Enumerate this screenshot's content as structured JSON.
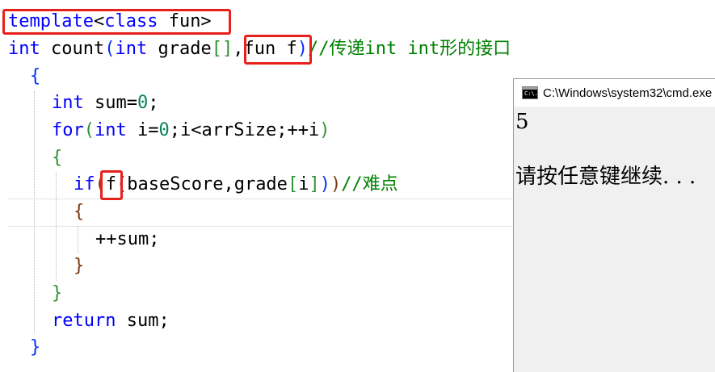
{
  "editor": {
    "lines": [
      {
        "tokens": [
          {
            "t": "template",
            "c": "kw"
          },
          {
            "t": "<",
            "c": ""
          },
          {
            "t": "class",
            "c": "kw"
          },
          {
            "t": " fun>",
            "c": ""
          }
        ]
      },
      {
        "tokens": [
          {
            "t": "int",
            "c": "kw"
          },
          {
            "t": " count",
            "c": ""
          },
          {
            "t": "(",
            "c": "br1"
          },
          {
            "t": "int",
            "c": "kw"
          },
          {
            "t": " grade",
            "c": ""
          },
          {
            "t": "[]",
            "c": "br2"
          },
          {
            "t": ",fun f",
            "c": ""
          },
          {
            "t": ")",
            "c": "br1"
          },
          {
            "t": "//传递",
            "c": "cm"
          },
          {
            "t": "int int",
            "c": "cm"
          },
          {
            "t": "形的接口",
            "c": "cm"
          }
        ]
      },
      {
        "tokens": [
          {
            "t": "{",
            "c": "br1"
          }
        ]
      },
      {
        "tokens": [
          {
            "t": "int",
            "c": "kw"
          },
          {
            "t": " sum=",
            "c": ""
          },
          {
            "t": "0",
            "c": "num"
          },
          {
            "t": ";",
            "c": ""
          }
        ]
      },
      {
        "tokens": [
          {
            "t": "for",
            "c": "kw"
          },
          {
            "t": "(",
            "c": "br2"
          },
          {
            "t": "int",
            "c": "kw"
          },
          {
            "t": " i=",
            "c": ""
          },
          {
            "t": "0",
            "c": "num"
          },
          {
            "t": ";i<arrSize;++i",
            "c": ""
          },
          {
            "t": ")",
            "c": "br2"
          }
        ]
      },
      {
        "tokens": [
          {
            "t": "{",
            "c": "br2"
          }
        ]
      },
      {
        "tokens": [
          {
            "t": "if",
            "c": "kw"
          },
          {
            "t": "(",
            "c": "br3"
          },
          {
            "t": "f",
            "c": ""
          },
          {
            "t": "(",
            "c": "br1"
          },
          {
            "t": "baseScore,grade",
            "c": ""
          },
          {
            "t": "[",
            "c": "br2"
          },
          {
            "t": "i",
            "c": ""
          },
          {
            "t": "]",
            "c": "br2"
          },
          {
            "t": ")",
            "c": "br1"
          },
          {
            "t": ")",
            "c": "br3"
          },
          {
            "t": "//难点",
            "c": "cm"
          }
        ]
      },
      {
        "tokens": [
          {
            "t": "{",
            "c": "br3"
          }
        ]
      },
      {
        "tokens": [
          {
            "t": "++sum;",
            "c": ""
          }
        ]
      },
      {
        "tokens": [
          {
            "t": "}",
            "c": "br3"
          }
        ]
      },
      {
        "tokens": [
          {
            "t": "}",
            "c": "br2"
          }
        ]
      },
      {
        "tokens": [
          {
            "t": "return",
            "c": "kw"
          },
          {
            "t": " sum;",
            "c": ""
          }
        ]
      },
      {
        "tokens": [
          {
            "t": "}",
            "c": "br1"
          }
        ]
      }
    ]
  },
  "console": {
    "title": "C:\\Windows\\system32\\cmd.exe",
    "icon": "cmd-icon",
    "icon_text": "C:\\.",
    "output_number": "5",
    "output_prompt": "请按任意键继续. . ."
  },
  "colors": {
    "keyword": "#0000ff",
    "comment": "#008000",
    "number": "#098658",
    "highlight": "#e8201b"
  }
}
